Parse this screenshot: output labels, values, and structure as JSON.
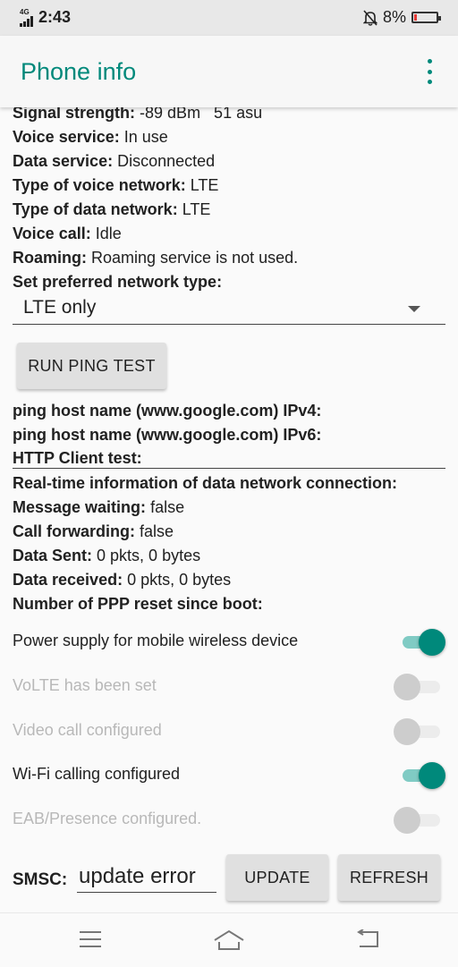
{
  "status_bar": {
    "network": "4G",
    "time": "2:43",
    "battery": "8%"
  },
  "app_bar": {
    "title": "Phone info"
  },
  "info": {
    "signal_strength": {
      "label": "Signal strength:",
      "value": "-89 dBm   51 asu"
    },
    "voice_service": {
      "label": "Voice service:",
      "value": "In use"
    },
    "data_service": {
      "label": "Data service:",
      "value": "Disconnected"
    },
    "voice_network": {
      "label": "Type of voice network:",
      "value": "LTE"
    },
    "data_network": {
      "label": "Type of data network:",
      "value": "LTE"
    },
    "voice_call": {
      "label": "Voice call:",
      "value": "Idle"
    },
    "roaming": {
      "label": "Roaming:",
      "value": "Roaming service is not used."
    },
    "preferred_network": {
      "label": "Set preferred network type:",
      "selected": "LTE only"
    }
  },
  "ping": {
    "button_label": "RUN PING TEST",
    "ipv4_label": "ping host name (www.google.com) IPv4:",
    "ipv6_label": "ping host name (www.google.com) IPv6:",
    "http_label": "HTTP Client test:"
  },
  "realtime": {
    "heading": "Real-time information of data network connection:",
    "message_waiting": {
      "label": "Message waiting:",
      "value": "false"
    },
    "call_forwarding": {
      "label": "Call forwarding:",
      "value": "false"
    },
    "data_sent": {
      "label": "Data Sent:",
      "value": "0 pkts, 0 bytes"
    },
    "data_received": {
      "label": "Data received:",
      "value": "0 pkts, 0 bytes"
    },
    "ppp_reset": {
      "label": "Number of PPP reset since boot:"
    }
  },
  "toggles": [
    {
      "label": "Power supply for mobile wireless device",
      "on": true,
      "enabled": true
    },
    {
      "label": "VoLTE has been set",
      "on": false,
      "enabled": false
    },
    {
      "label": "Video call configured",
      "on": false,
      "enabled": false
    },
    {
      "label": "Wi-Fi calling configured",
      "on": true,
      "enabled": true
    },
    {
      "label": "EAB/Presence configured.",
      "on": false,
      "enabled": false
    }
  ],
  "smsc": {
    "label": "SMSC:",
    "value": "update error",
    "update_label": "UPDATE",
    "refresh_label": "REFRESH"
  },
  "colors": {
    "accent": "#00897b",
    "accent_light": "#80cbc4"
  }
}
